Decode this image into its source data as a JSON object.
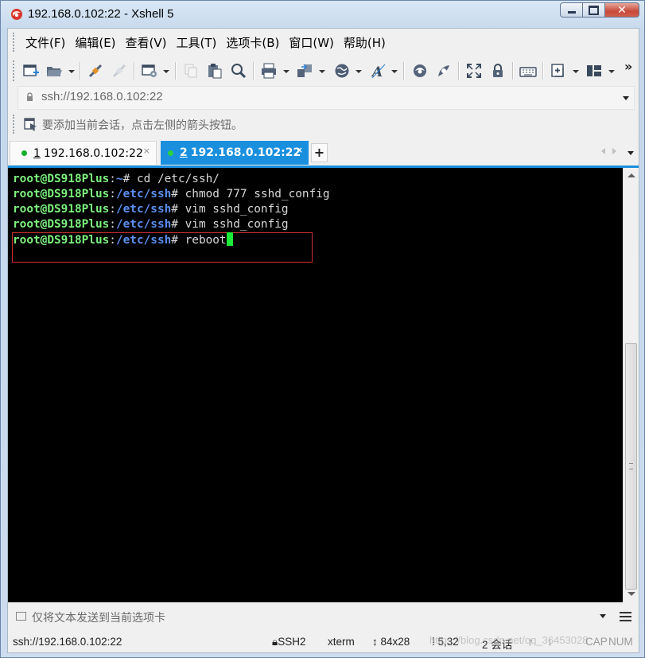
{
  "window": {
    "title": "192.168.0.102:22 - Xshell 5",
    "controls": {
      "minimize": "minimize",
      "maximize": "maximize",
      "close": "✕"
    }
  },
  "menu": [
    "文件(F)",
    "编辑(E)",
    "查看(V)",
    "工具(T)",
    "选项卡(B)",
    "窗口(W)",
    "帮助(H)"
  ],
  "toolbar": {
    "icons": [
      "new-session-icon",
      "open-folder-icon",
      "connect-icon",
      "disconnect-icon",
      "properties-icon",
      "copy-icon",
      "paste-icon",
      "find-icon",
      "print-icon",
      "transfer-icon",
      "globe-icon",
      "font-icon",
      "xftp-icon",
      "xmanager-icon",
      "fullscreen-icon",
      "lock-icon",
      "keyboard-icon",
      "new-tab-icon",
      "layout-icon",
      "more-icon"
    ],
    "more_label": "»"
  },
  "address": {
    "value": "ssh://192.168.0.102:22"
  },
  "hint": {
    "text": "要添加当前会话，点击左侧的箭头按钮。"
  },
  "tabs": [
    {
      "num": "1",
      "label": "192.168.0.102:22",
      "active": false,
      "close": "×"
    },
    {
      "num": "2",
      "label": "192.168.0.102:22",
      "active": true,
      "close": "×"
    }
  ],
  "tab_add": "+",
  "terminal": {
    "lines": [
      {
        "user": "root@DS918Plus",
        "sep": ":",
        "path": "~",
        "sym": "#",
        "cmd": " cd /etc/ssh/"
      },
      {
        "user": "root@DS918Plus",
        "sep": ":",
        "path": "/etc/ssh",
        "sym": "#",
        "cmd": " chmod 777 sshd_config"
      },
      {
        "user": "root@DS918Plus",
        "sep": ":",
        "path": "/etc/ssh",
        "sym": "#",
        "cmd": " vim sshd_config"
      },
      {
        "user": "root@DS918Plus",
        "sep": ":",
        "path": "/etc/ssh",
        "sym": "#",
        "cmd": " vim sshd_config"
      },
      {
        "user": "root@DS918Plus",
        "sep": ":",
        "path": "/etc/ssh",
        "sym": "#",
        "cmd": " reboot"
      }
    ],
    "colors": {
      "background": "#000000",
      "user": "#7df27d",
      "path": "#5a8ff0",
      "cursor": "#1ee838",
      "highlight": "#d33030"
    }
  },
  "sendbar": {
    "text": "仅将文本发送到当前选项卡"
  },
  "status": {
    "address": "ssh://192.168.0.102:22",
    "protocol": "SSH2",
    "term": "xterm",
    "size": "84x28",
    "cursor": "5,32",
    "sessions": "2 会话",
    "cap": "CAP",
    "num": "NUM",
    "watermark": "https://blog.csdn.net/qq_36453028"
  }
}
